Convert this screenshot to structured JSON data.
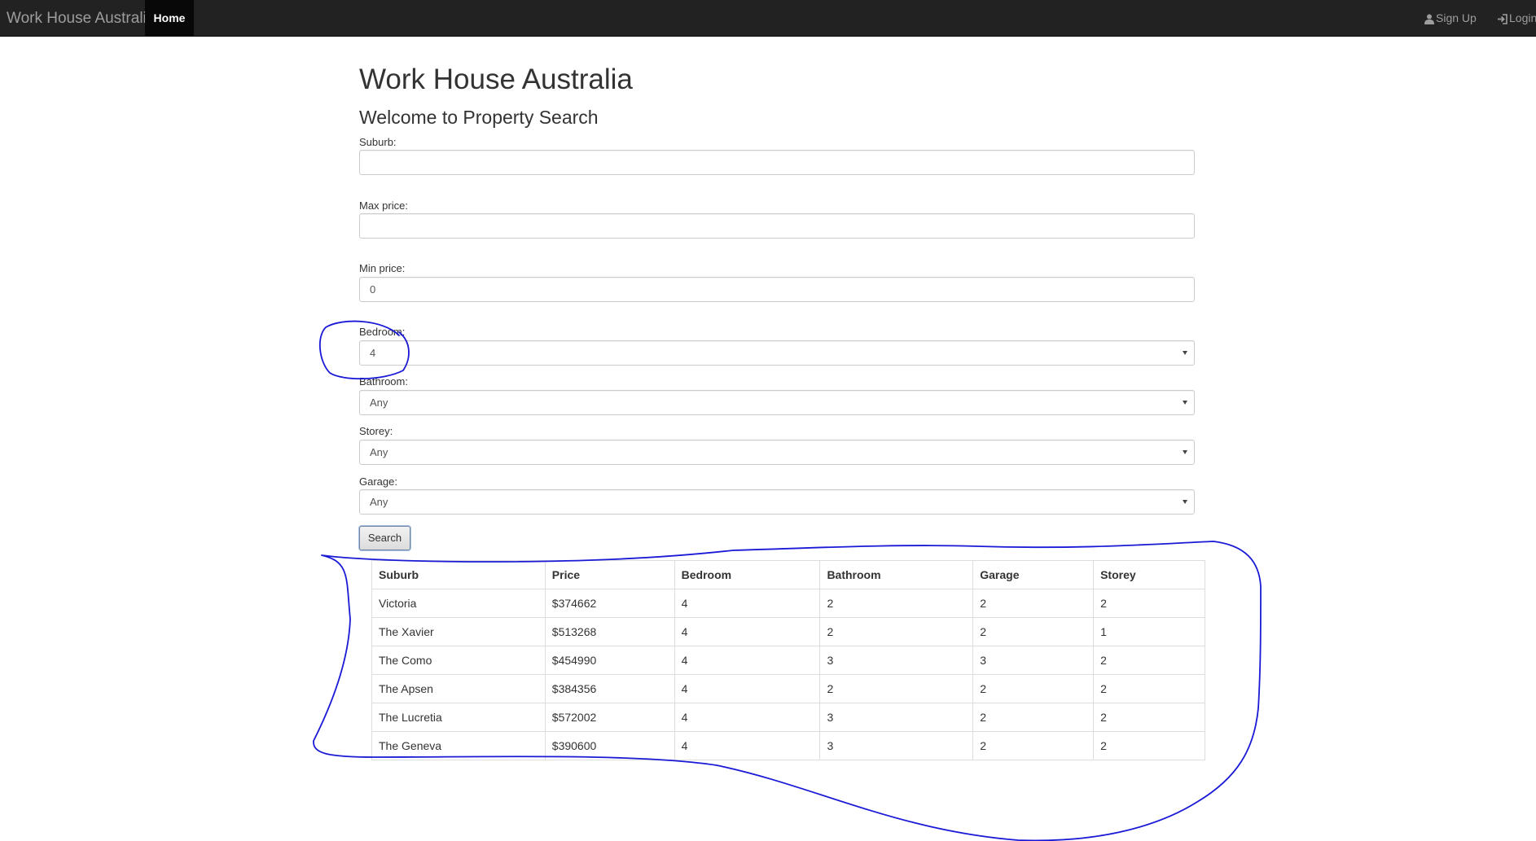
{
  "navbar": {
    "brand": "Work House Australia",
    "home_label": "Home",
    "signup_label": "Sign Up",
    "signup_icon": "user-icon",
    "login_label": "Login",
    "login_icon": "login-icon",
    "background_color": "#222222"
  },
  "page": {
    "title": "Work House Australia",
    "subtitle": "Welcome to Property Search"
  },
  "form": {
    "suburb": {
      "label": "Suburb:",
      "value": ""
    },
    "max_price": {
      "label": "Max price:",
      "value": ""
    },
    "min_price": {
      "label": "Min price:",
      "value": "0"
    },
    "bedroom": {
      "label": "Bedroom:",
      "value": "4"
    },
    "bathroom": {
      "label": "Bathroom:",
      "value": "Any"
    },
    "storey": {
      "label": "Storey:",
      "value": "Any"
    },
    "garage": {
      "label": "Garage:",
      "value": "Any"
    },
    "search_label": "Search"
  },
  "table": {
    "headers": [
      "Suburb",
      "Price",
      "Bedroom",
      "Bathroom",
      "Garage",
      "Storey"
    ],
    "rows": [
      [
        "Victoria",
        "$374662",
        "4",
        "2",
        "2",
        "2"
      ],
      [
        "The Xavier",
        "$513268",
        "4",
        "2",
        "2",
        "1"
      ],
      [
        "The Como",
        "$454990",
        "4",
        "3",
        "3",
        "2"
      ],
      [
        "The Apsen",
        "$384356",
        "4",
        "2",
        "2",
        "2"
      ],
      [
        "The Lucretia",
        "$572002",
        "4",
        "3",
        "2",
        "2"
      ],
      [
        "The Geneva",
        "$390600",
        "4",
        "3",
        "2",
        "2"
      ]
    ]
  },
  "annotation_color": "#1a1ad6"
}
